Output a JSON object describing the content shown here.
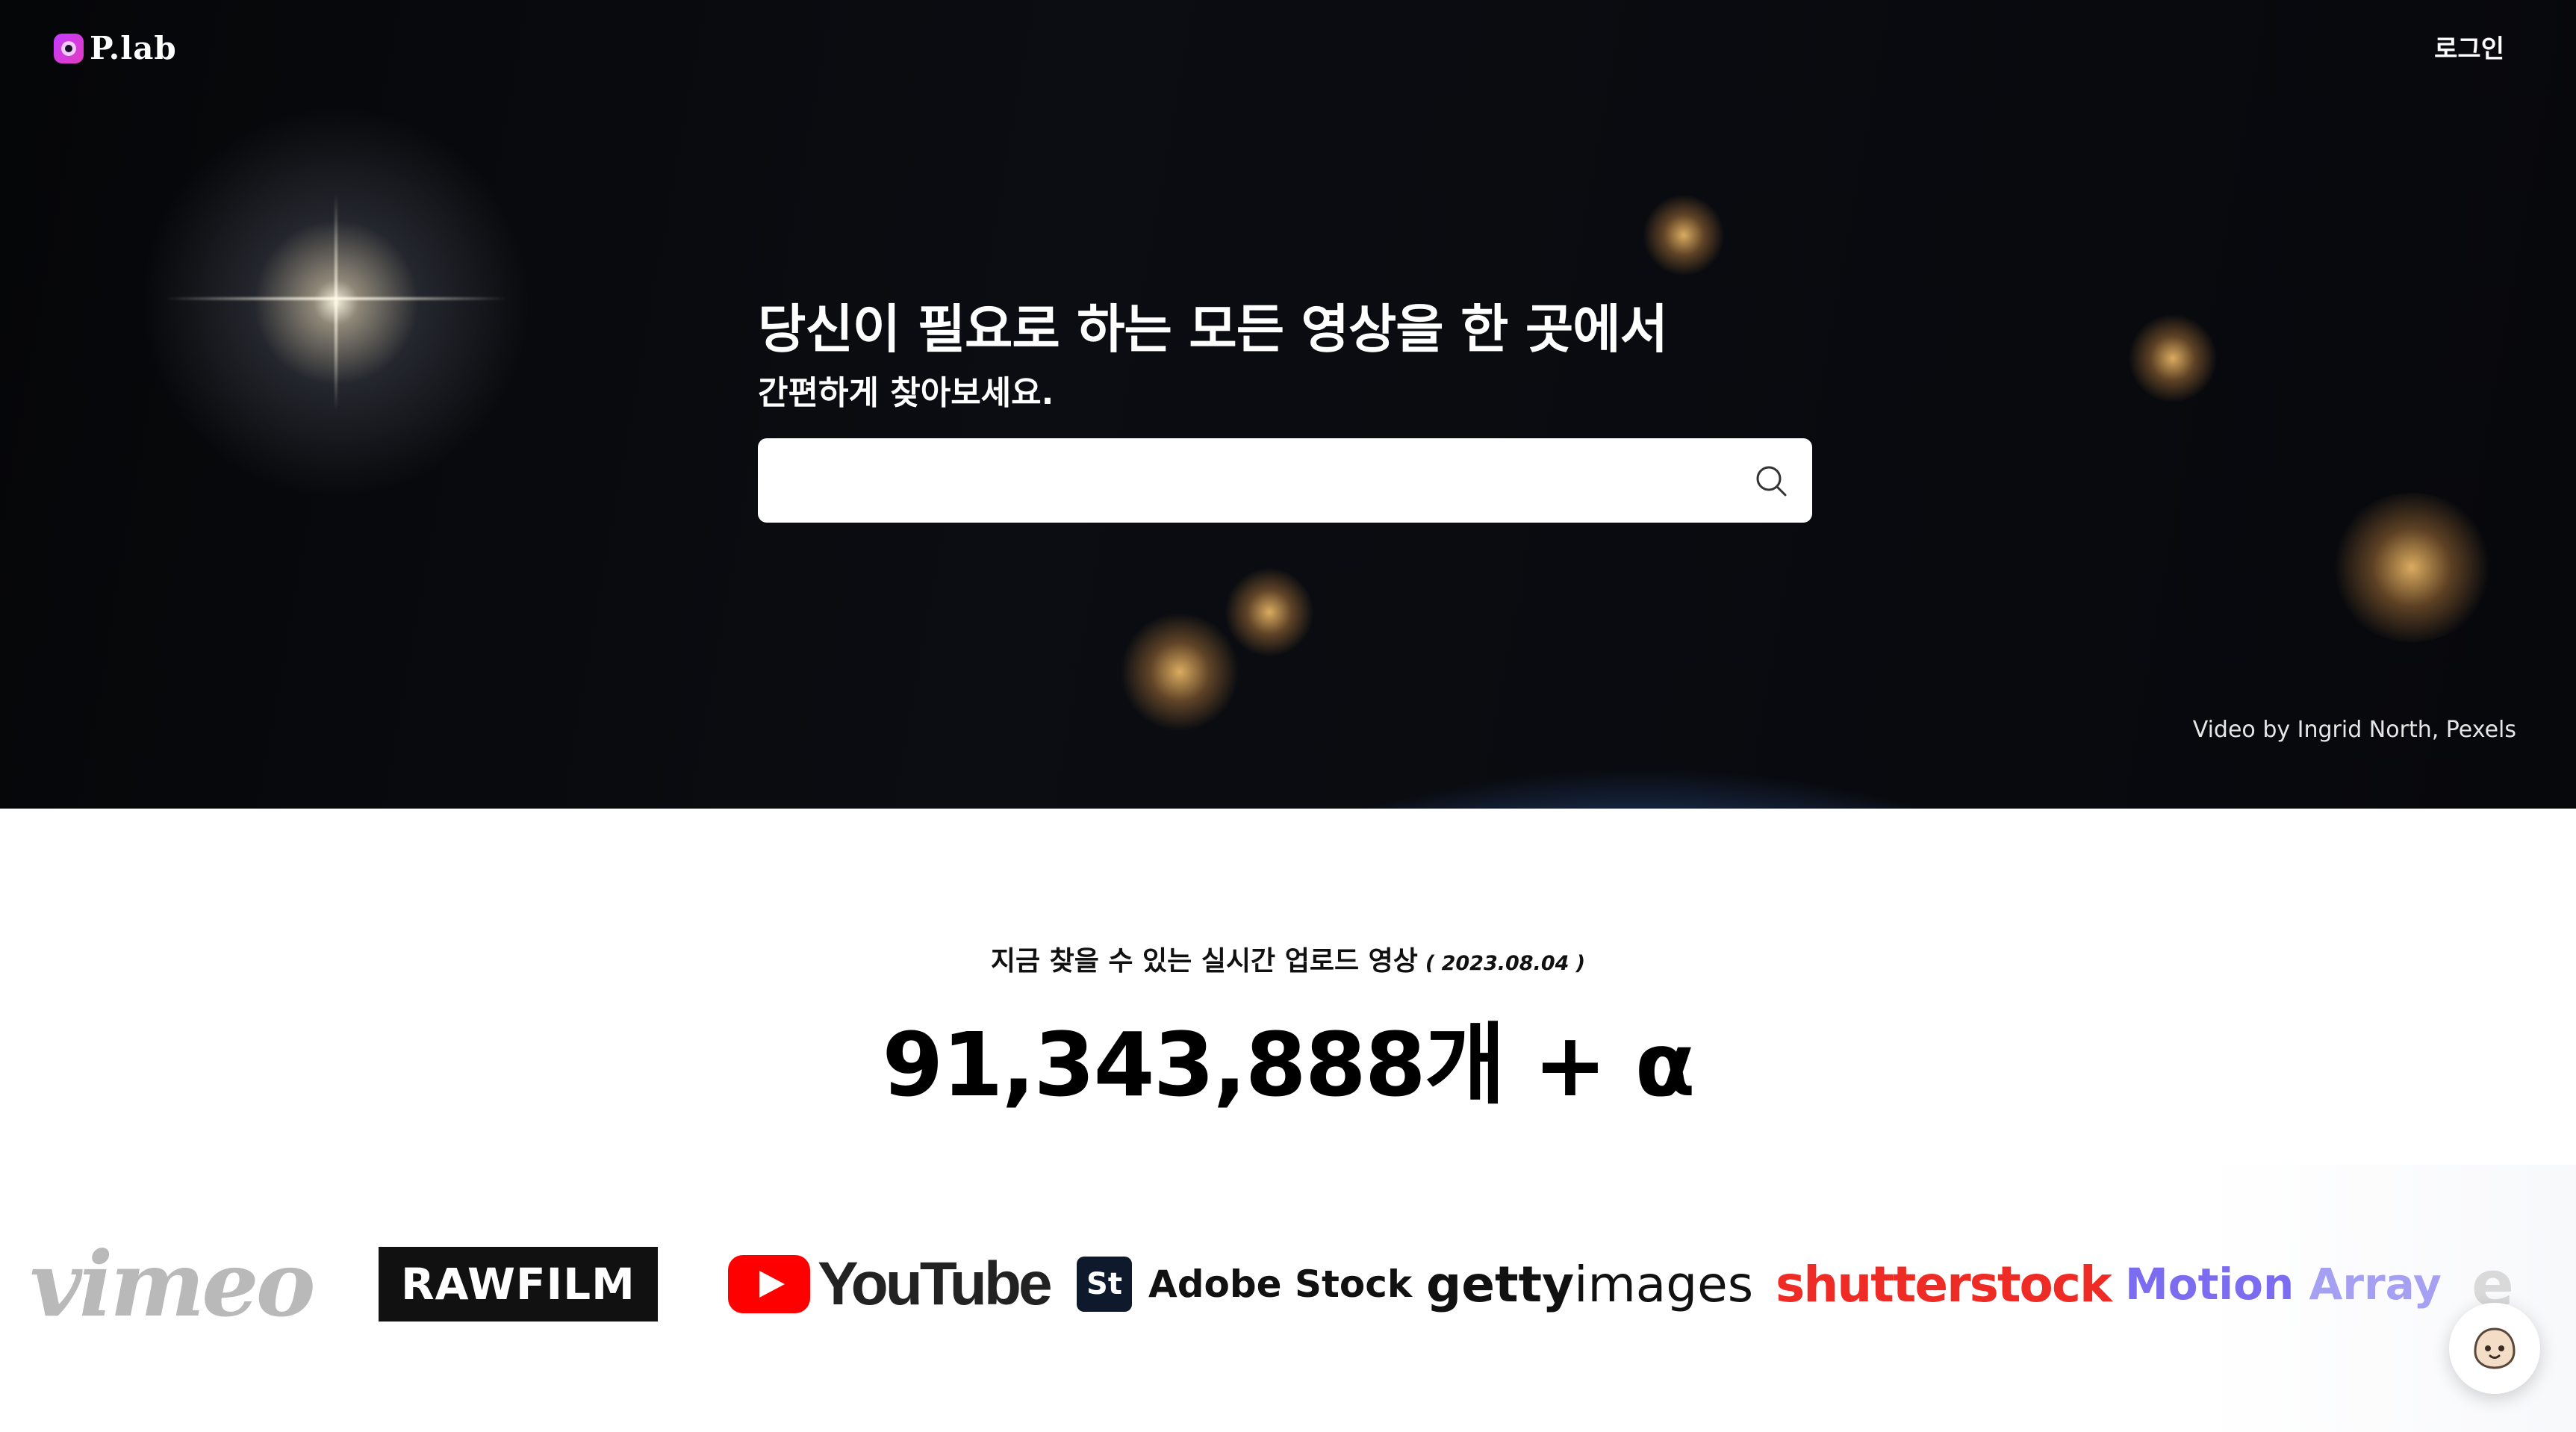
{
  "header": {
    "logo_text": "P.lab",
    "login_label": "로그인"
  },
  "hero": {
    "title": "당신이 필요로 하는 모든 영상을 한 곳에서",
    "subtitle": "간편하게 찾아보세요.",
    "search": {
      "value": "",
      "placeholder": ""
    },
    "credit": "Video by Ingrid North, Pexels"
  },
  "stats": {
    "label": "지금 찾을 수 있는 실시간 업로드 영상",
    "date": "( 2023.08.04 )",
    "count": "91,343,888개 + α"
  },
  "brands": {
    "vimeo": "vimeo",
    "rawfilm": "RAWFILM",
    "youtube": "YouTube",
    "adobe_stock_badge": "St",
    "adobe_stock": "Adobe Stock",
    "getty_1": "getty",
    "getty_2": "images",
    "shutterstock": "shutterstock",
    "motion_1": "Motion",
    "motion_2": "Array",
    "partial": "e"
  },
  "colors": {
    "accent": "#c63bff",
    "youtube_red": "#ff0000",
    "shutterstock_red": "#ee2b24",
    "motion_array": "#7c6cf0"
  }
}
